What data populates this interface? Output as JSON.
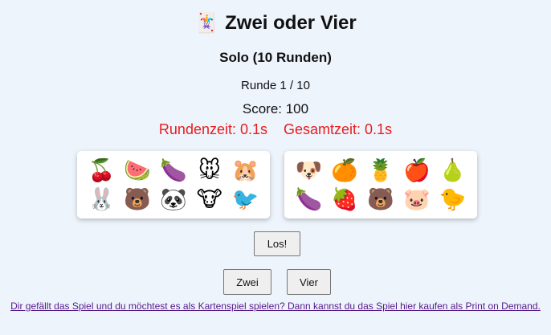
{
  "header": {
    "logo_icon": "🃏",
    "title": "Zwei oder Vier",
    "mode": "Solo (10 Runden)"
  },
  "status": {
    "round": "Runde 1 / 10",
    "score": "Score: 100",
    "round_time": "Rundenzeit: 0.1s",
    "total_time": "Gesamtzeit: 0.1s"
  },
  "cards": {
    "left": [
      "🍒",
      "🍉",
      "🍆",
      "🐭",
      "🐹",
      "🐰",
      "🐻",
      "🐼",
      "🐮",
      "🐦"
    ],
    "right": [
      "🐶",
      "🍊",
      "🍍",
      "🍎",
      "🍐",
      "🍆",
      "🍓",
      "🐻",
      "🐷",
      "🐤"
    ]
  },
  "buttons": {
    "go": "Los!",
    "two": "Zwei",
    "four": "Vier"
  },
  "footer": {
    "link_text": "Dir gefällt das Spiel und du möchtest es als Kartenspiel spielen? Dann kannst du das Spiel hier kaufen als Print on Demand."
  },
  "colors": {
    "background": "#eef4fc",
    "time_text": "#e81c1c",
    "link": "#551a8b"
  }
}
